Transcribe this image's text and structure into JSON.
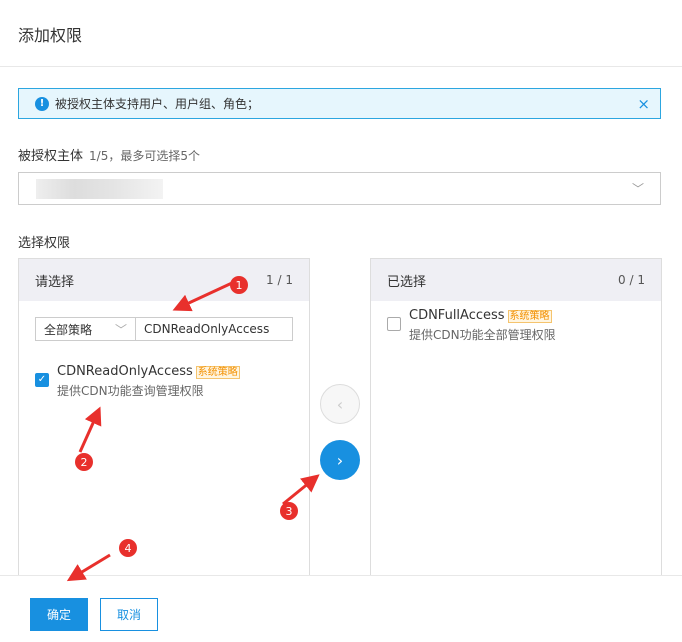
{
  "dialog": {
    "title": "添加权限"
  },
  "alert": {
    "text": "被授权主体支持用户、用户组、角色；",
    "icon": "info-icon",
    "close": "×"
  },
  "principal": {
    "label": "被授权主体",
    "hint": "1/5，最多可选择5个",
    "chevron": "﹀"
  },
  "permissions": {
    "label": "选择权限"
  },
  "left_panel": {
    "title": "请选择",
    "count": "1 / 1",
    "filter_option": "全部策略",
    "filter_chevron": "﹀",
    "search_value": "CDNReadOnlyAccess",
    "items": [
      {
        "name": "CDNReadOnlyAccess",
        "tag": "系统策略",
        "desc": "提供CDN功能查询管理权限",
        "checked": true
      }
    ]
  },
  "right_panel": {
    "title": "已选择",
    "count": "0 / 1",
    "items": [
      {
        "name": "CDNFullAccess",
        "tag": "系统策略",
        "desc": "提供CDN功能全部管理权限",
        "checked": false
      }
    ]
  },
  "transfer": {
    "left": "‹",
    "right": "›"
  },
  "footer": {
    "ok": "确定",
    "cancel": "取消"
  },
  "annotations": {
    "color": "#e8302c",
    "steps": [
      "1",
      "2",
      "3",
      "4"
    ]
  }
}
